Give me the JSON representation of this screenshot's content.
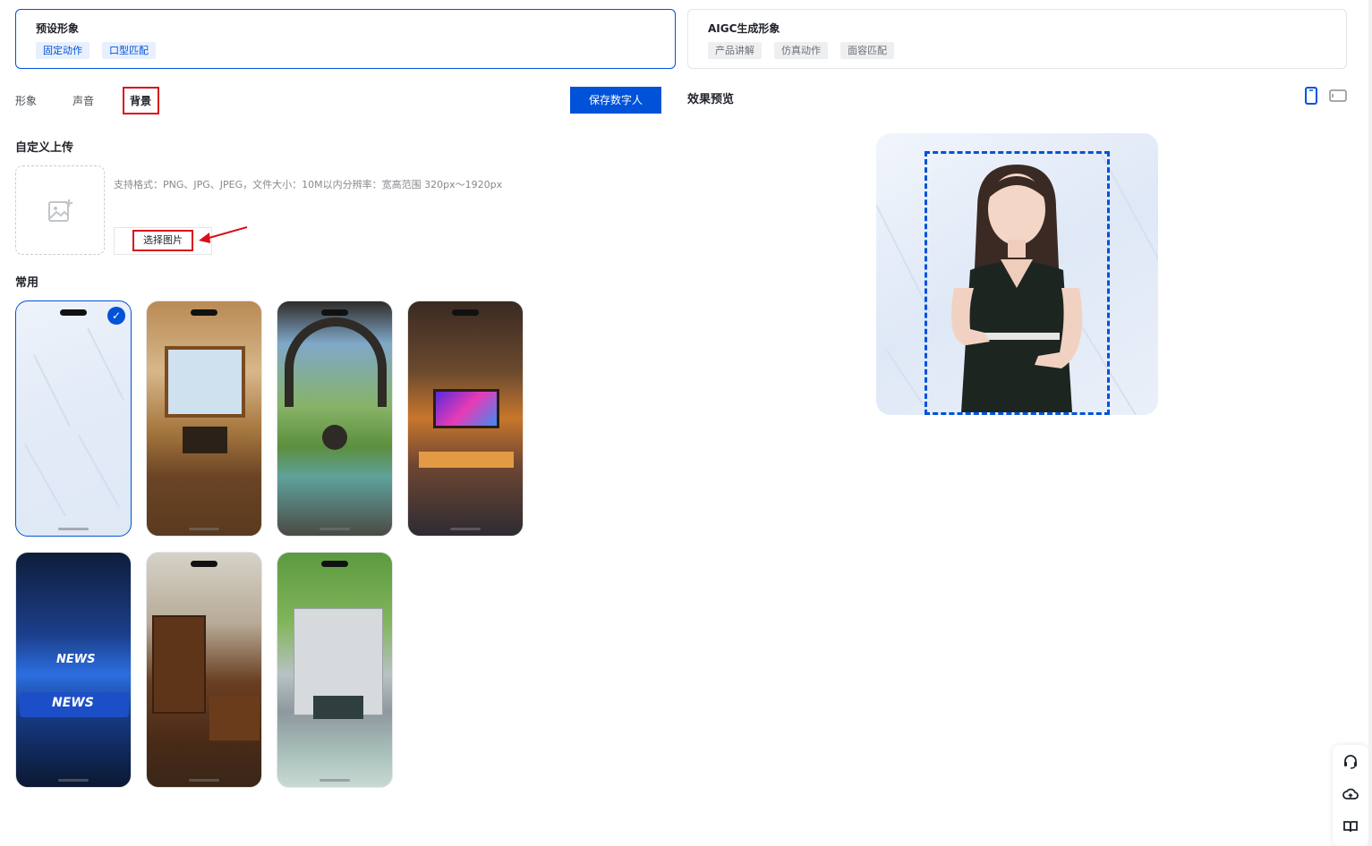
{
  "avatar_types": [
    {
      "title": "预设形象",
      "tags": [
        "固定动作",
        "口型匹配"
      ],
      "active": true
    },
    {
      "title": "AIGC生成形象",
      "tags": [
        "产品讲解",
        "仿真动作",
        "面容匹配"
      ],
      "active": false
    }
  ],
  "tabs": [
    "形象",
    "声音",
    "背景"
  ],
  "active_tab": "背景",
  "save_button": "保存数字人",
  "custom_upload": {
    "title": "自定义上传",
    "hint": "支持格式：PNG、JPG、JPEG，文件大小：10M以内分辨率：宽高范围 320px～1920px",
    "choose_button": "选择图片"
  },
  "common_section": {
    "title": "常用",
    "backgrounds": [
      {
        "id": "light-texture",
        "selected": true
      },
      {
        "id": "classroom-window",
        "selected": false
      },
      {
        "id": "chinese-garden",
        "selected": false
      },
      {
        "id": "neon-stage",
        "selected": false
      },
      {
        "id": "news-studio",
        "selected": false,
        "overlay_text": [
          "NEWS",
          "NEWS"
        ]
      },
      {
        "id": "wood-office",
        "selected": false
      },
      {
        "id": "campus-building",
        "selected": false
      }
    ]
  },
  "preview": {
    "title": "效果预览",
    "orientations": [
      "portrait-icon",
      "landscape-icon"
    ],
    "active_orientation": "portrait-icon"
  },
  "side_tools": [
    "headset-icon",
    "cloud-upload-icon",
    "book-icon"
  ],
  "colors": {
    "accent": "#0052d9",
    "annotation_red": "#d8101c"
  }
}
